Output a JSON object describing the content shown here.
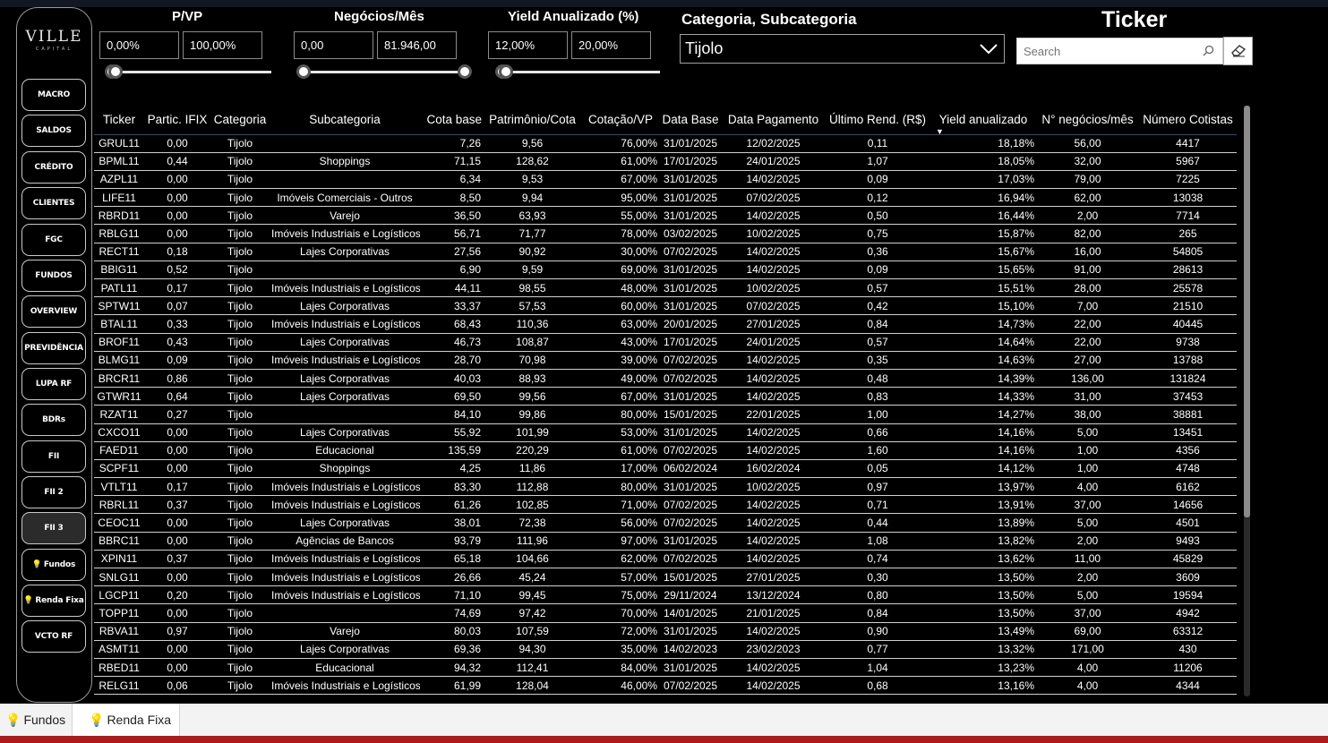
{
  "brand": {
    "name": "VILLE",
    "sub": "CAPITAL"
  },
  "nav": [
    {
      "label": "MACRO"
    },
    {
      "label": "SALDOS"
    },
    {
      "label": "CRÉDITO"
    },
    {
      "label": "CLIENTES"
    },
    {
      "label": "FGC"
    },
    {
      "label": "FUNDOS"
    },
    {
      "label": "OVERVIEW"
    },
    {
      "label": "PREVIDÊNCIA"
    },
    {
      "label": "LUPA RF"
    },
    {
      "label": "BDRs"
    },
    {
      "label": "FII"
    },
    {
      "label": "FII 2"
    },
    {
      "label": "FII 3"
    },
    {
      "label": "Fundos"
    },
    {
      "label": "Renda Fixa"
    },
    {
      "label": "VCTO RF"
    }
  ],
  "filters": {
    "pvp": {
      "label": "P/VP",
      "min": "0,00%",
      "max": "100,00%"
    },
    "negocios": {
      "label": "Negócios/Mês",
      "min": "0,00",
      "max": "81.946,00"
    },
    "yield": {
      "label": "Yield Anualizado (%)",
      "min": "12,00%",
      "max": "20,00%"
    },
    "categoria": {
      "label": "Categoria, Subcategoria",
      "value": "Tijolo"
    },
    "ticker": {
      "label": "Ticker",
      "placeholder": "Search"
    }
  },
  "table": {
    "columns": [
      "Ticker",
      "Partic. IFIX",
      "Categoria",
      "Subcategoria",
      "Cota base",
      "Patrimônio/Cota",
      "Cotação/VP",
      "Data Base",
      "Data Pagamento",
      "Último Rend. (R$)",
      "Yield anualizado",
      "N° negócios/mês",
      "Número Cotistas"
    ],
    "rows": [
      [
        "GRUL11",
        "0,00",
        "Tijolo",
        "",
        "7,26",
        "9,56",
        "76,00%",
        "31/01/2025",
        "12/02/2025",
        "0,11",
        "18,18%",
        "56,00",
        "4417"
      ],
      [
        "BPML11",
        "0,44",
        "Tijolo",
        "Shoppings",
        "71,15",
        "128,62",
        "61,00%",
        "17/01/2025",
        "24/01/2025",
        "1,07",
        "18,05%",
        "32,00",
        "5967"
      ],
      [
        "AZPL11",
        "0,00",
        "Tijolo",
        "",
        "6,34",
        "9,53",
        "67,00%",
        "31/01/2025",
        "14/02/2025",
        "0,09",
        "17,03%",
        "79,00",
        "7225"
      ],
      [
        "LIFE11",
        "0,00",
        "Tijolo",
        "Imóveis Comerciais - Outros",
        "8,50",
        "9,94",
        "95,00%",
        "31/01/2025",
        "07/02/2025",
        "0,12",
        "16,94%",
        "62,00",
        "13038"
      ],
      [
        "RBRD11",
        "0,00",
        "Tijolo",
        "Varejo",
        "36,50",
        "63,93",
        "55,00%",
        "31/01/2025",
        "14/02/2025",
        "0,50",
        "16,44%",
        "2,00",
        "7714"
      ],
      [
        "RBLG11",
        "0,00",
        "Tijolo",
        "Imóveis Industriais e Logísticos",
        "56,71",
        "71,77",
        "78,00%",
        "03/02/2025",
        "10/02/2025",
        "0,75",
        "15,87%",
        "82,00",
        "265"
      ],
      [
        "RECT11",
        "0,18",
        "Tijolo",
        "Lajes Corporativas",
        "27,56",
        "90,92",
        "30,00%",
        "07/02/2025",
        "14/02/2025",
        "0,36",
        "15,67%",
        "16,00",
        "54805"
      ],
      [
        "BBIG11",
        "0,52",
        "Tijolo",
        "",
        "6,90",
        "9,59",
        "69,00%",
        "31/01/2025",
        "14/02/2025",
        "0,09",
        "15,65%",
        "91,00",
        "28613"
      ],
      [
        "PATL11",
        "0,17",
        "Tijolo",
        "Imóveis Industriais e Logísticos",
        "44,11",
        "98,55",
        "48,00%",
        "31/01/2025",
        "10/02/2025",
        "0,57",
        "15,51%",
        "28,00",
        "25578"
      ],
      [
        "SPTW11",
        "0,07",
        "Tijolo",
        "Lajes Corporativas",
        "33,37",
        "57,53",
        "60,00%",
        "31/01/2025",
        "07/02/2025",
        "0,42",
        "15,10%",
        "7,00",
        "21510"
      ],
      [
        "BTAL11",
        "0,33",
        "Tijolo",
        "Imóveis Industriais e Logísticos",
        "68,43",
        "110,36",
        "63,00%",
        "20/01/2025",
        "27/01/2025",
        "0,84",
        "14,73%",
        "22,00",
        "40445"
      ],
      [
        "BROF11",
        "0,43",
        "Tijolo",
        "Lajes Corporativas",
        "46,73",
        "108,87",
        "43,00%",
        "17/01/2025",
        "24/01/2025",
        "0,57",
        "14,64%",
        "22,00",
        "9738"
      ],
      [
        "BLMG11",
        "0,09",
        "Tijolo",
        "Imóveis Industriais e Logísticos",
        "28,70",
        "70,98",
        "39,00%",
        "07/02/2025",
        "14/02/2025",
        "0,35",
        "14,63%",
        "27,00",
        "13788"
      ],
      [
        "BRCR11",
        "0,86",
        "Tijolo",
        "Lajes Corporativas",
        "40,03",
        "88,93",
        "49,00%",
        "07/02/2025",
        "14/02/2025",
        "0,48",
        "14,39%",
        "136,00",
        "131824"
      ],
      [
        "GTWR11",
        "0,64",
        "Tijolo",
        "Lajes Corporativas",
        "69,50",
        "99,56",
        "67,00%",
        "31/01/2025",
        "14/02/2025",
        "0,83",
        "14,33%",
        "31,00",
        "37453"
      ],
      [
        "RZAT11",
        "0,27",
        "Tijolo",
        "",
        "84,10",
        "99,86",
        "80,00%",
        "15/01/2025",
        "22/01/2025",
        "1,00",
        "14,27%",
        "38,00",
        "38881"
      ],
      [
        "CXCO11",
        "0,00",
        "Tijolo",
        "Lajes Corporativas",
        "55,92",
        "101,99",
        "53,00%",
        "31/01/2025",
        "14/02/2025",
        "0,66",
        "14,16%",
        "5,00",
        "13451"
      ],
      [
        "FAED11",
        "0,00",
        "Tijolo",
        "Educacional",
        "135,59",
        "220,29",
        "61,00%",
        "07/02/2025",
        "14/02/2025",
        "1,60",
        "14,16%",
        "1,00",
        "4356"
      ],
      [
        "SCPF11",
        "0,00",
        "Tijolo",
        "Shoppings",
        "4,25",
        "11,86",
        "17,00%",
        "06/02/2024",
        "16/02/2024",
        "0,05",
        "14,12%",
        "1,00",
        "4748"
      ],
      [
        "VTLT11",
        "0,17",
        "Tijolo",
        "Imóveis Industriais e Logísticos",
        "83,30",
        "112,88",
        "80,00%",
        "31/01/2025",
        "10/02/2025",
        "0,97",
        "13,97%",
        "4,00",
        "6162"
      ],
      [
        "RBRL11",
        "0,37",
        "Tijolo",
        "Imóveis Industriais e Logísticos",
        "61,26",
        "102,85",
        "71,00%",
        "07/02/2025",
        "14/02/2025",
        "0,71",
        "13,91%",
        "37,00",
        "14656"
      ],
      [
        "CEOC11",
        "0,00",
        "Tijolo",
        "Lajes Corporativas",
        "38,01",
        "72,38",
        "56,00%",
        "07/02/2025",
        "14/02/2025",
        "0,44",
        "13,89%",
        "5,00",
        "4501"
      ],
      [
        "BBRC11",
        "0,00",
        "Tijolo",
        "Agências de Bancos",
        "93,79",
        "111,96",
        "97,00%",
        "31/01/2025",
        "14/02/2025",
        "1,08",
        "13,82%",
        "2,00",
        "9493"
      ],
      [
        "XPIN11",
        "0,37",
        "Tijolo",
        "Imóveis Industriais e Logísticos",
        "65,18",
        "104,66",
        "62,00%",
        "07/02/2025",
        "14/02/2025",
        "0,74",
        "13,62%",
        "11,00",
        "45829"
      ],
      [
        "SNLG11",
        "0,00",
        "Tijolo",
        "Imóveis Industriais e Logísticos",
        "26,66",
        "45,24",
        "57,00%",
        "15/01/2025",
        "27/01/2025",
        "0,30",
        "13,50%",
        "2,00",
        "3609"
      ],
      [
        "LGCP11",
        "0,20",
        "Tijolo",
        "Imóveis Industriais e Logísticos",
        "71,10",
        "99,45",
        "75,00%",
        "29/11/2024",
        "13/12/2024",
        "0,80",
        "13,50%",
        "5,00",
        "19594"
      ],
      [
        "TOPP11",
        "0,00",
        "Tijolo",
        "",
        "74,69",
        "97,42",
        "70,00%",
        "14/01/2025",
        "21/01/2025",
        "0,84",
        "13,50%",
        "37,00",
        "4942"
      ],
      [
        "RBVA11",
        "0,97",
        "Tijolo",
        "Varejo",
        "80,03",
        "107,59",
        "72,00%",
        "31/01/2025",
        "14/02/2025",
        "0,90",
        "13,49%",
        "69,00",
        "63312"
      ],
      [
        "ASMT11",
        "0,00",
        "Tijolo",
        "Lajes Corporativas",
        "69,36",
        "94,30",
        "35,00%",
        "14/02/2023",
        "23/02/2023",
        "0,77",
        "13,32%",
        "171,00",
        "430"
      ],
      [
        "RBED11",
        "0,00",
        "Tijolo",
        "Educacional",
        "94,32",
        "112,41",
        "84,00%",
        "31/01/2025",
        "14/02/2025",
        "1,04",
        "13,23%",
        "4,00",
        "11206"
      ],
      [
        "RELG11",
        "0,06",
        "Tijolo",
        "Imóveis Industriais e Logísticos",
        "61,99",
        "128,04",
        "46,00%",
        "07/02/2025",
        "14/02/2025",
        "0,68",
        "13,16%",
        "4,00",
        "4344"
      ]
    ]
  },
  "bottom_tabs": [
    {
      "label": "Fundos"
    },
    {
      "label": "Renda Fixa"
    }
  ],
  "colors": {
    "accent_red": "#b01a1a",
    "header_line": "#2b4a77",
    "bulb": "#f4c430"
  }
}
